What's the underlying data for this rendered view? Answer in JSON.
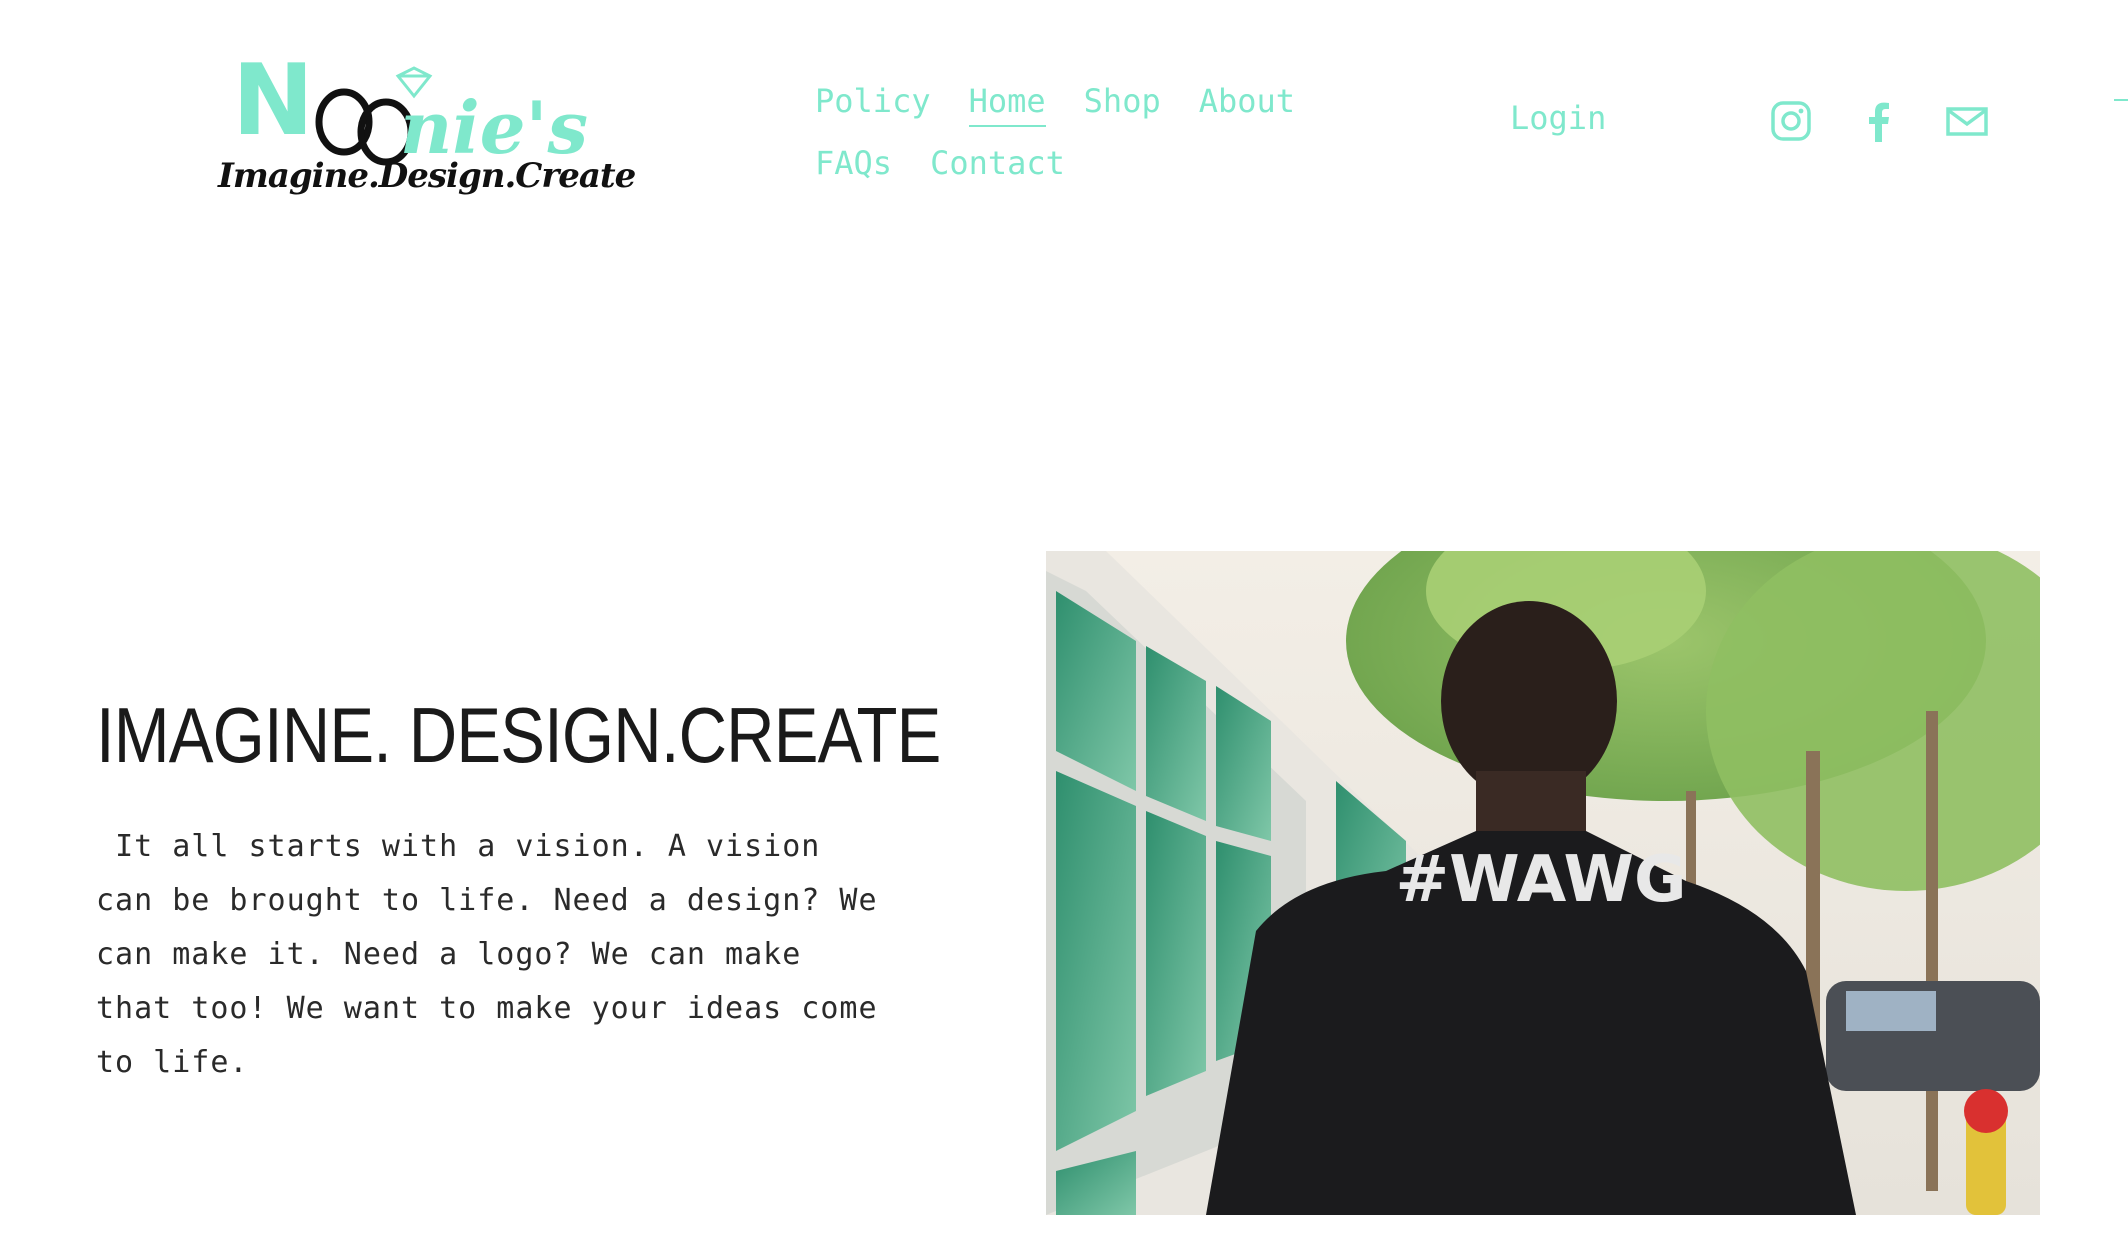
{
  "logo": {
    "letter_n": "N",
    "rest": "nie's",
    "tagline": "Imagine.Design.Create",
    "accent": "#7fe8cc"
  },
  "nav": {
    "row1": [
      {
        "label": "Policy",
        "active": false
      },
      {
        "label": "Home",
        "active": true
      },
      {
        "label": "Shop",
        "active": false
      },
      {
        "label": "About",
        "active": false
      }
    ],
    "row2": [
      {
        "label": "FAQs",
        "active": false
      },
      {
        "label": "Contact",
        "active": false
      }
    ]
  },
  "login_label": "Login",
  "social": [
    {
      "icon": "instagram-icon"
    },
    {
      "icon": "facebook-icon"
    },
    {
      "icon": "email-icon"
    }
  ],
  "hero": {
    "title": "IMAGINE. DESIGN.CREATE",
    "body": " It all starts with a vision. A vision\ncan be brought to life. Need a design? We\ncan make it. Need a logo? We can make\nthat too! We want to make your ideas come\nto life."
  },
  "photo": {
    "shirt_text": "#WAWG"
  },
  "colors": {
    "accent": "#7fe8cc",
    "text": "#1a1a1a",
    "background": "#ffffff"
  }
}
